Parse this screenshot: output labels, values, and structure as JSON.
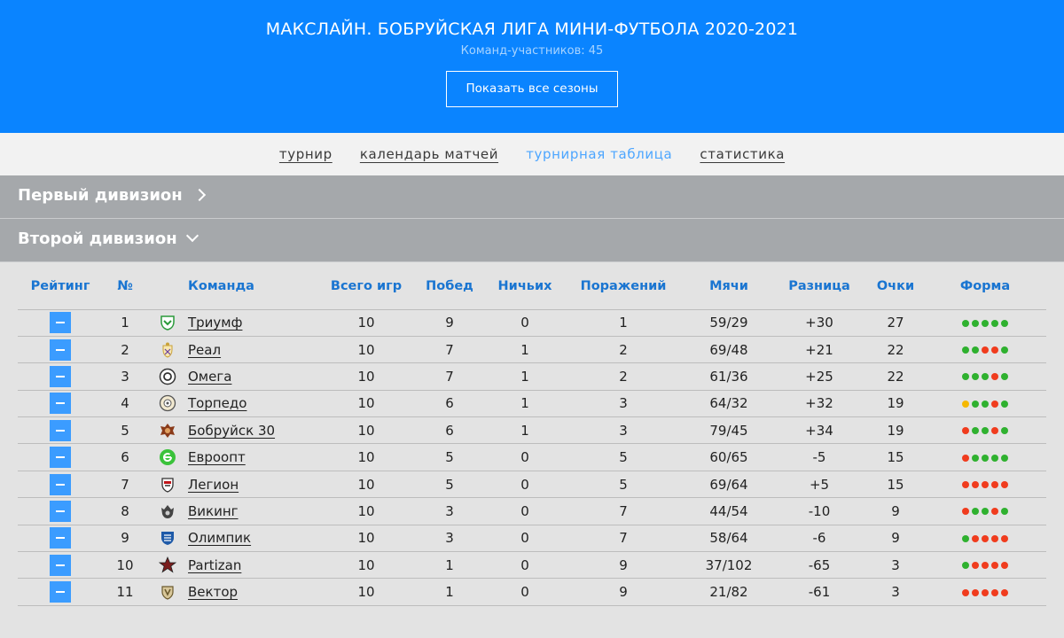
{
  "header": {
    "title": "МАКСЛАЙН. БОБРУЙСКАЯ ЛИГА МИНИ-ФУТБОЛА 2020-2021",
    "subtitle": "Команд-участников: 45",
    "seasons_button": "Показать все сезоны"
  },
  "nav": {
    "items": [
      "турнир",
      "календарь матчей",
      "турнирная таблица",
      "статистика"
    ],
    "active_index": 2
  },
  "divisions": {
    "first": "Первый дивизион",
    "second": "Второй дивизион"
  },
  "table": {
    "headers": {
      "rating": "Рейтинг",
      "num": "№",
      "team": "Команда",
      "games": "Всего игр",
      "wins": "Побед",
      "draws": "Ничьих",
      "losses": "Поражений",
      "balls": "Мячи",
      "diff": "Разница",
      "points": "Очки",
      "form": "Форма"
    },
    "rows": [
      {
        "num": "1",
        "team": "Триумф",
        "games": "10",
        "wins": "9",
        "draws": "0",
        "losses": "1",
        "balls": "59/29",
        "diff": "+30",
        "points": "27",
        "logo": "triumph-logo-icon",
        "form": [
          "W",
          "W",
          "W",
          "W",
          "W"
        ]
      },
      {
        "num": "2",
        "team": "Реал",
        "games": "10",
        "wins": "7",
        "draws": "1",
        "losses": "2",
        "balls": "69/48",
        "diff": "+21",
        "points": "22",
        "logo": "real-logo-icon",
        "form": [
          "W",
          "W",
          "L",
          "L",
          "W"
        ]
      },
      {
        "num": "3",
        "team": "Омега",
        "games": "10",
        "wins": "7",
        "draws": "1",
        "losses": "2",
        "balls": "61/36",
        "diff": "+25",
        "points": "22",
        "logo": "omega-logo-icon",
        "form": [
          "W",
          "W",
          "W",
          "L",
          "W"
        ]
      },
      {
        "num": "4",
        "team": "Торпедо",
        "games": "10",
        "wins": "6",
        "draws": "1",
        "losses": "3",
        "balls": "64/32",
        "diff": "+32",
        "points": "19",
        "logo": "torpedo-logo-icon",
        "form": [
          "D",
          "W",
          "W",
          "L",
          "W"
        ]
      },
      {
        "num": "5",
        "team": "Бобруйск 30",
        "games": "10",
        "wins": "6",
        "draws": "1",
        "losses": "3",
        "balls": "79/45",
        "diff": "+34",
        "points": "19",
        "logo": "bobruisk30-logo-icon",
        "form": [
          "L",
          "W",
          "W",
          "L",
          "W"
        ]
      },
      {
        "num": "6",
        "team": "Евроопт",
        "games": "10",
        "wins": "5",
        "draws": "0",
        "losses": "5",
        "balls": "60/65",
        "diff": "-5",
        "points": "15",
        "logo": "evroopt-logo-icon",
        "form": [
          "L",
          "W",
          "W",
          "W",
          "W"
        ]
      },
      {
        "num": "7",
        "team": "Легион",
        "games": "10",
        "wins": "5",
        "draws": "0",
        "losses": "5",
        "balls": "69/64",
        "diff": "+5",
        "points": "15",
        "logo": "legion-logo-icon",
        "form": [
          "L",
          "L",
          "L",
          "L",
          "L"
        ]
      },
      {
        "num": "8",
        "team": "Викинг",
        "games": "10",
        "wins": "3",
        "draws": "0",
        "losses": "7",
        "balls": "44/54",
        "diff": "-10",
        "points": "9",
        "logo": "viking-logo-icon",
        "form": [
          "L",
          "W",
          "W",
          "L",
          "W"
        ]
      },
      {
        "num": "9",
        "team": "Олимпик",
        "games": "10",
        "wins": "3",
        "draws": "0",
        "losses": "7",
        "balls": "58/64",
        "diff": "-6",
        "points": "9",
        "logo": "olimpik-logo-icon",
        "form": [
          "W",
          "L",
          "L",
          "L",
          "L"
        ]
      },
      {
        "num": "10",
        "team": "Partizan",
        "games": "10",
        "wins": "1",
        "draws": "0",
        "losses": "9",
        "balls": "37/102",
        "diff": "-65",
        "points": "3",
        "logo": "partizan-logo-icon",
        "form": [
          "W",
          "L",
          "L",
          "L",
          "L"
        ]
      },
      {
        "num": "11",
        "team": "Вектор",
        "games": "10",
        "wins": "1",
        "draws": "0",
        "losses": "9",
        "balls": "21/82",
        "diff": "-61",
        "points": "3",
        "logo": "vektor-logo-icon",
        "form": [
          "L",
          "L",
          "L",
          "L",
          "L"
        ]
      }
    ]
  },
  "colors": {
    "header_bg": "#0a84ff",
    "accent": "#1a75d1",
    "win": "#2fb12f",
    "draw": "#f5b800",
    "loss": "#f03c1e"
  }
}
